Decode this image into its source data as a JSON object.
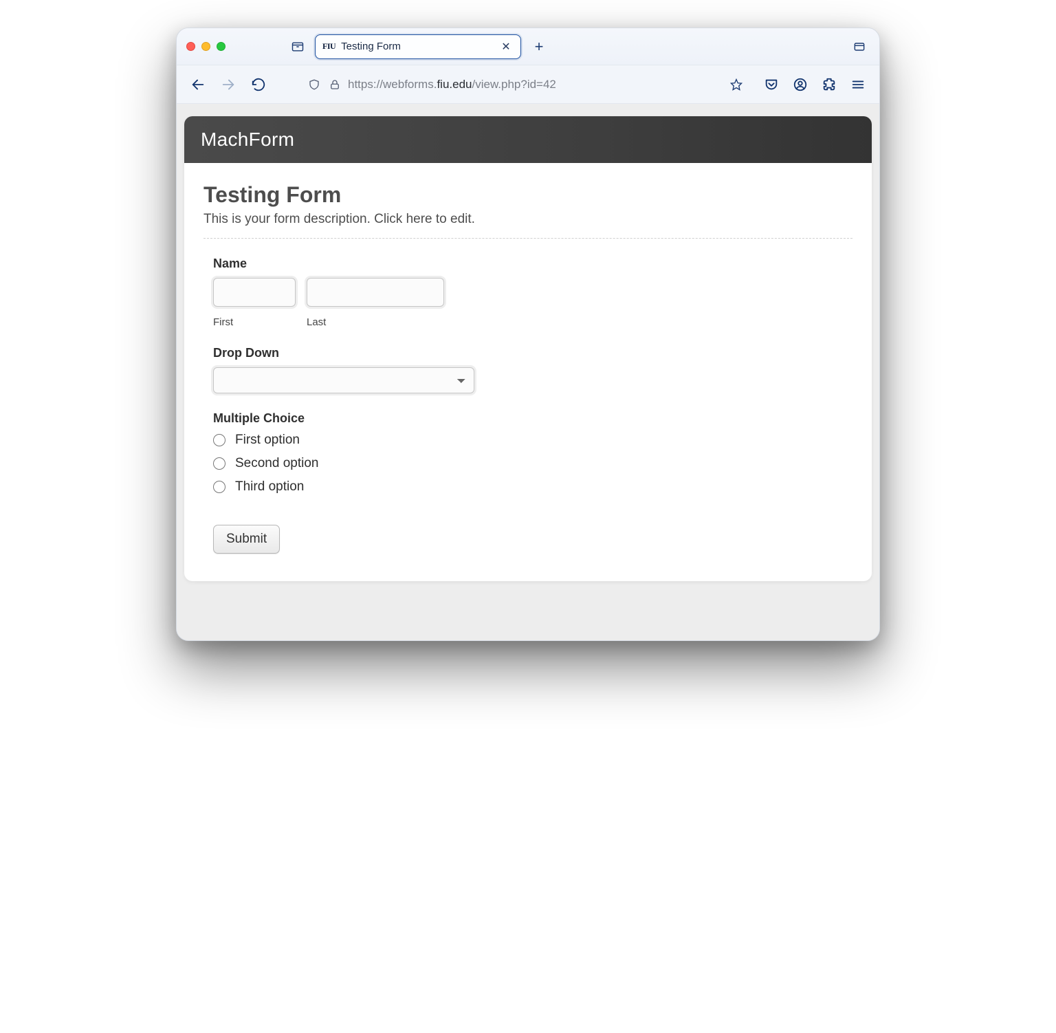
{
  "browser": {
    "tab": {
      "favicon": "FIU",
      "title": "Testing Form"
    },
    "url_prefix": "https://webforms.",
    "url_host": "fiu.edu",
    "url_suffix": "/view.php?id=42"
  },
  "app": {
    "brand": "MachForm",
    "form_title": "Testing Form",
    "form_desc": "This is your form description. Click here to edit."
  },
  "fields": {
    "name": {
      "label": "Name",
      "first_sub": "First",
      "last_sub": "Last"
    },
    "dropdown": {
      "label": "Drop Down",
      "selected": ""
    },
    "multiple_choice": {
      "label": "Multiple Choice",
      "options": [
        "First option",
        "Second option",
        "Third option"
      ]
    },
    "submit_label": "Submit"
  }
}
